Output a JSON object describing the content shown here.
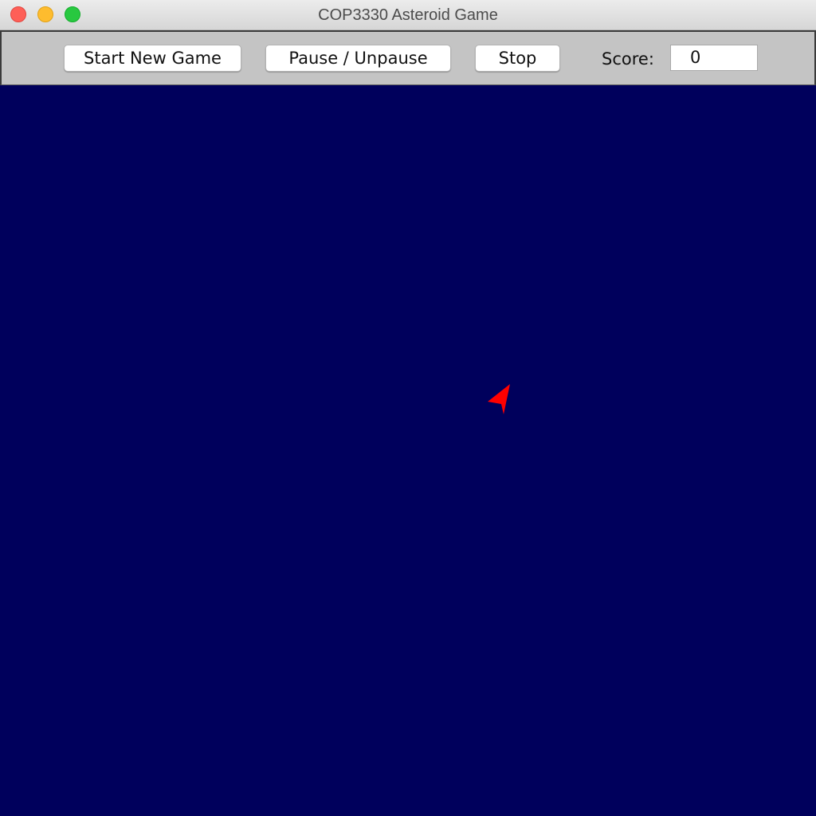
{
  "window": {
    "title": "COP3330 Asteroid Game"
  },
  "toolbar": {
    "start_label": "Start New Game",
    "pause_label": "Pause / Unpause",
    "stop_label": "Stop",
    "score_label": "Score:",
    "score_value": "0"
  },
  "game": {
    "background_color": "#00005c",
    "ship_color": "#ff0000",
    "ship_icon": "spaceship-icon"
  }
}
